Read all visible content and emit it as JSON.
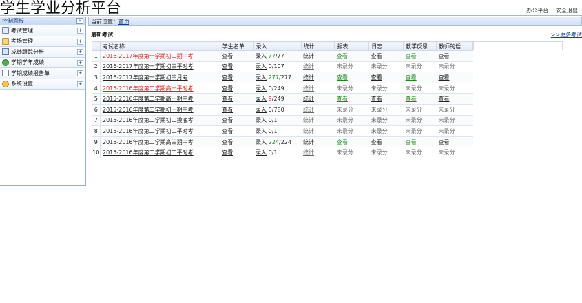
{
  "app": {
    "title": "学生学业分析平台"
  },
  "top_links": {
    "office": "办公平台",
    "separator": "|",
    "logout": "安全退出"
  },
  "sidebar": {
    "header_title": "控制面板",
    "collapse_glyph": "«",
    "items": [
      {
        "label": "考试管理",
        "icon": "exam-icon",
        "expand": "+"
      },
      {
        "label": "考场管理",
        "icon": "folder-icon",
        "expand": "+"
      },
      {
        "label": "成绩跟踪分析",
        "icon": "chart-icon",
        "expand": "+"
      },
      {
        "label": "学期学年成绩",
        "icon": "green-circle-icon",
        "expand": "+"
      },
      {
        "label": "学期成绩报告单",
        "icon": "report-icon",
        "expand": "+"
      },
      {
        "label": "系统设置",
        "icon": "gear-icon",
        "expand": "+"
      }
    ]
  },
  "breadcrumb": {
    "prefix": "当前位置：",
    "home": "首页"
  },
  "section": {
    "title": "最新考试",
    "more_link": ">>更多考试"
  },
  "table": {
    "headers": [
      "考试名称",
      "学生名单",
      "录入",
      "统计",
      "报表",
      "日志",
      "教学反思",
      "教师的话"
    ],
    "rows": [
      {
        "idx": "1",
        "name": "2016-2017年度第一学期初二期中考",
        "name_red": true,
        "roster": "查看",
        "entry": "录入",
        "entered": "77",
        "entered_red": false,
        "total": "/77",
        "stats": "统计",
        "stats_muted": false,
        "report": "查看",
        "report_muted": false,
        "log": "查看",
        "log_muted": false,
        "reflection": "查看",
        "reflection_muted": false,
        "teacher": "查看",
        "teacher_muted": false
      },
      {
        "idx": "2",
        "name": "2016-2017年度第一学期初三平时考",
        "name_red": false,
        "roster": "查看",
        "entry": "录入",
        "entered": "",
        "entered_red": false,
        "total": "0/107",
        "stats": "统计",
        "stats_muted": true,
        "report": "未录分",
        "report_muted": true,
        "log": "未录分",
        "log_muted": true,
        "reflection": "未录分",
        "reflection_muted": true,
        "teacher": "未录分",
        "teacher_muted": true
      },
      {
        "idx": "3",
        "name": "2016-2017年度第一学期初三月考",
        "name_red": false,
        "roster": "查看",
        "entry": "录入",
        "entered": "277",
        "entered_red": false,
        "total": "/277",
        "stats": "统计",
        "stats_muted": false,
        "report": "查看",
        "report_muted": false,
        "log": "查看",
        "log_muted": false,
        "reflection": "查看",
        "reflection_muted": false,
        "teacher": "查看",
        "teacher_muted": false
      },
      {
        "idx": "4",
        "name": "2015-2016年度第二学期高一平时考",
        "name_red": true,
        "roster": "查看",
        "entry": "录入",
        "entered": "",
        "entered_red": false,
        "total": "0/249",
        "stats": "统计",
        "stats_muted": true,
        "report": "未录分",
        "report_muted": true,
        "log": "未录分",
        "log_muted": true,
        "reflection": "未录分",
        "reflection_muted": true,
        "teacher": "未录分",
        "teacher_muted": true
      },
      {
        "idx": "5",
        "name": "2015-2016年度第二学期高一期中考",
        "name_red": false,
        "roster": "查看",
        "entry": "录入",
        "entered": "9",
        "entered_red": true,
        "total": "/249",
        "stats": "统计",
        "stats_muted": false,
        "report": "查看",
        "report_muted": false,
        "log": "查看",
        "log_muted": false,
        "reflection": "查看",
        "reflection_muted": false,
        "teacher": "查看",
        "teacher_muted": false
      },
      {
        "idx": "6",
        "name": "2015-2016年度第二学期初一期中考",
        "name_red": false,
        "roster": "查看",
        "entry": "录入",
        "entered": "",
        "entered_red": false,
        "total": "0/780",
        "stats": "统计",
        "stats_muted": true,
        "report": "未录分",
        "report_muted": true,
        "log": "未录分",
        "log_muted": true,
        "reflection": "未录分",
        "reflection_muted": true,
        "teacher": "未录分",
        "teacher_muted": true
      },
      {
        "idx": "7",
        "name": "2015-2016年度第二学期初二摸底考",
        "name_red": false,
        "roster": "查看",
        "entry": "录入",
        "entered": "",
        "entered_red": false,
        "total": "0/1",
        "stats": "统计",
        "stats_muted": true,
        "report": "未录分",
        "report_muted": true,
        "log": "未录分",
        "log_muted": true,
        "reflection": "未录分",
        "reflection_muted": true,
        "teacher": "未录分",
        "teacher_muted": true
      },
      {
        "idx": "8",
        "name": "2015-2016年度第二学期初二平时考",
        "name_red": false,
        "roster": "查看",
        "entry": "录入",
        "entered": "",
        "entered_red": false,
        "total": "0/1",
        "stats": "统计",
        "stats_muted": true,
        "report": "未录分",
        "report_muted": true,
        "log": "未录分",
        "log_muted": true,
        "reflection": "未录分",
        "reflection_muted": true,
        "teacher": "未录分",
        "teacher_muted": true
      },
      {
        "idx": "9",
        "name": "2015-2016年度第二学期高三期中考",
        "name_red": false,
        "roster": "查看",
        "entry": "录入",
        "entered": "224",
        "entered_red": false,
        "total": "/224",
        "stats": "统计",
        "stats_muted": false,
        "report": "查看",
        "report_muted": false,
        "log": "查看",
        "log_muted": false,
        "reflection": "查看",
        "reflection_muted": false,
        "teacher": "查看",
        "teacher_muted": false
      },
      {
        "idx": "10",
        "name": "2015-2016年度第二学期初二平时考",
        "name_red": false,
        "roster": "查看",
        "entry": "录入",
        "entered": "",
        "entered_red": false,
        "total": "0/1",
        "stats": "统计",
        "stats_muted": true,
        "report": "未录分",
        "report_muted": true,
        "log": "未录分",
        "log_muted": true,
        "reflection": "未录分",
        "reflection_muted": true,
        "teacher": "未录分",
        "teacher_muted": true
      }
    ]
  },
  "colors": {
    "accent_blue": "#9fb7d8",
    "link_red": "#e0201a",
    "link_green": "#1a8a1a"
  }
}
